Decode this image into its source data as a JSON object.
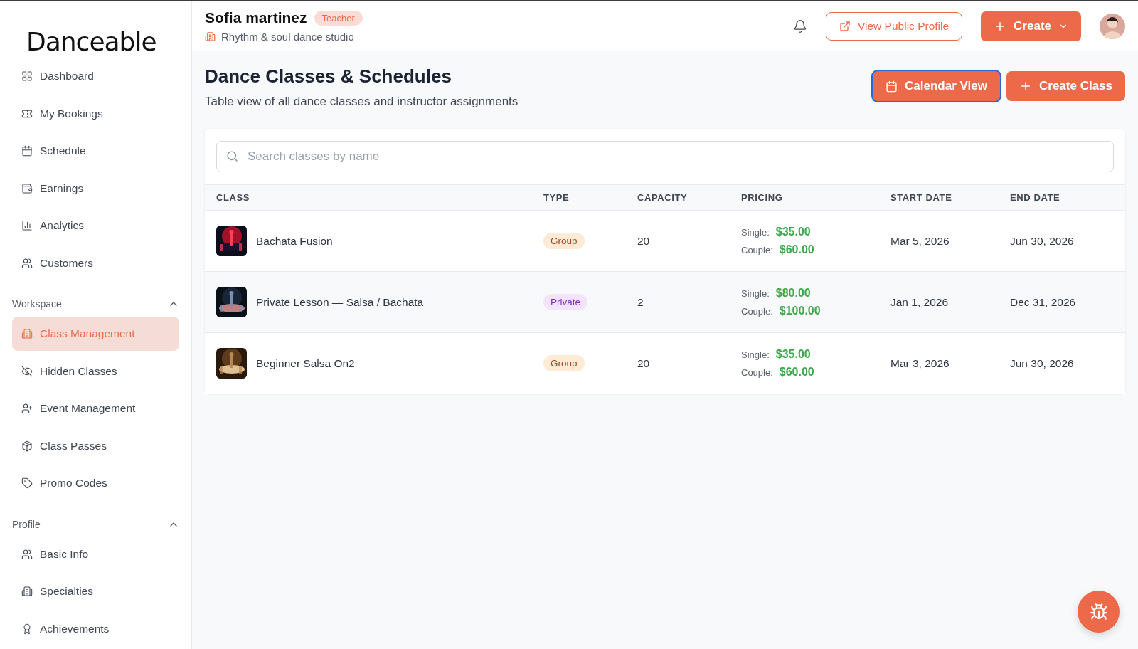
{
  "sidebar": {
    "logo": "Danceable",
    "items": [
      {
        "label": "Dashboard",
        "selected": false
      },
      {
        "label": "My Bookings",
        "selected": false
      },
      {
        "label": "Schedule",
        "selected": false
      },
      {
        "label": "Earnings",
        "selected": false
      },
      {
        "label": "Analytics",
        "selected": false
      },
      {
        "label": "Customers",
        "selected": false
      }
    ],
    "sections": [
      {
        "title": "Workspace",
        "expanded": true,
        "items": [
          {
            "label": "Class Management",
            "selected": true
          },
          {
            "label": "Hidden Classes",
            "selected": false
          },
          {
            "label": "Event Management",
            "selected": false
          },
          {
            "label": "Class Passes",
            "selected": false
          },
          {
            "label": "Promo Codes",
            "selected": false
          }
        ]
      },
      {
        "title": "Profile",
        "expanded": true,
        "items": [
          {
            "label": "Basic Info",
            "selected": false
          },
          {
            "label": "Specialties",
            "selected": false
          },
          {
            "label": "Achievements",
            "selected": false
          }
        ]
      }
    ]
  },
  "header": {
    "user_name": "Sofia martinez",
    "role": "Teacher",
    "studio": "Rhythm & soul dance studio",
    "view_profile": "View Public Profile",
    "create": "Create"
  },
  "page": {
    "title": "Dance Classes & Schedules",
    "subtitle": "Table view of all dance classes and instructor assignments",
    "actions": [
      {
        "label": "Calendar View",
        "focused": true
      },
      {
        "label": "Create Class",
        "focused": false
      }
    ]
  },
  "search": {
    "placeholder": "Search classes by name"
  },
  "table": {
    "columns": [
      "CLASS",
      "TYPE",
      "CAPACITY",
      "PRICING",
      "START DATE",
      "END DATE"
    ],
    "rows": [
      {
        "name": "Bachata Fusion",
        "type": {
          "label": "Group",
          "kind": "group"
        },
        "capacity": "20",
        "single_label": "Single:",
        "single": "$35.00",
        "couple_label": "Couple:",
        "couple": "$60.00",
        "start": "Mar 5, 2026",
        "end": "Jun 30, 2026"
      },
      {
        "name": "Private Lesson — Salsa / Bachata",
        "type": {
          "label": "Private",
          "kind": "private"
        },
        "capacity": "2",
        "single_label": "Single:",
        "single": "$80.00",
        "couple_label": "Couple:",
        "couple": "$100.00",
        "start": "Jan 1, 2026",
        "end": "Dec 31, 2026"
      },
      {
        "name": "Beginner Salsa On2",
        "type": {
          "label": "Group",
          "kind": "group"
        },
        "capacity": "20",
        "single_label": "Single:",
        "single": "$35.00",
        "couple_label": "Couple:",
        "couple": "$60.00",
        "start": "Mar 3, 2026",
        "end": "Jun 30, 2026"
      }
    ]
  }
}
